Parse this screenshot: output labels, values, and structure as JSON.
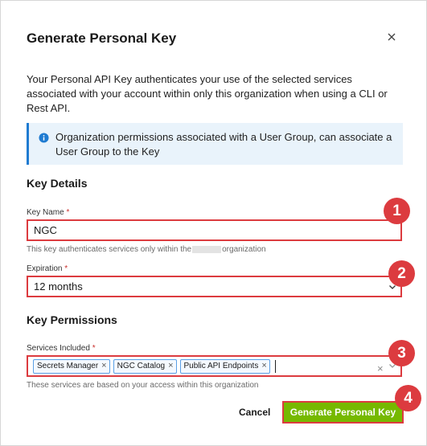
{
  "dialog": {
    "title": "Generate Personal Key",
    "close_icon": "close-icon",
    "description": "Your Personal API Key authenticates your use of the selected services associated with your account within only this organization when using a CLI or Rest API.",
    "info": {
      "icon": "info-icon",
      "text": "Organization permissions associated with a User Group, can associate a User Group to the Key"
    }
  },
  "key_details": {
    "heading": "Key Details",
    "key_name": {
      "label": "Key Name",
      "required_mark": "*",
      "value": "NGC",
      "helper_before": "This key authenticates services only within the",
      "helper_after": "organization"
    },
    "expiration": {
      "label": "Expiration",
      "required_mark": "*",
      "value": "12 months"
    }
  },
  "key_permissions": {
    "heading": "Key Permissions",
    "services": {
      "label": "Services Included",
      "required_mark": "*",
      "chips": [
        "Secrets Manager",
        "NGC Catalog",
        "Public API Endpoints"
      ],
      "chip_remove": "×",
      "clear": "×",
      "helper": "These services are based on your access within this organization"
    }
  },
  "footer": {
    "cancel_label": "Cancel",
    "generate_label": "Generate Personal Key"
  },
  "badges": [
    "1",
    "2",
    "3",
    "4"
  ],
  "colors": {
    "accent_green": "#76b900",
    "highlight_red": "#dc3b3f",
    "info_blue": "#1f7bd1",
    "info_bg": "#e9f3fb",
    "chip_border": "#5aa0e6"
  }
}
